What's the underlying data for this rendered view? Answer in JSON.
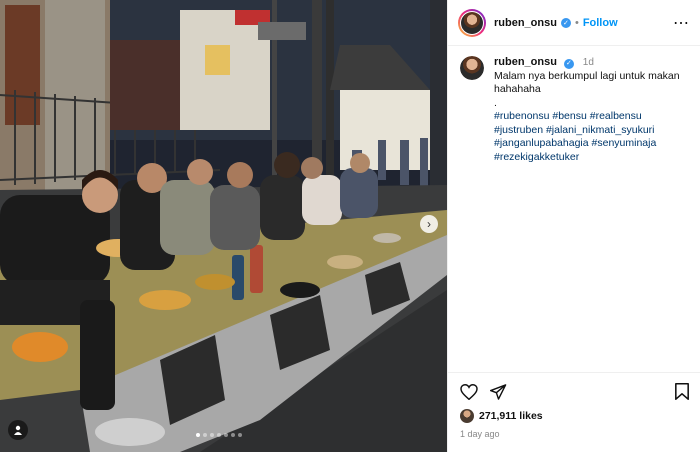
{
  "post": {
    "username": "ruben_onsu",
    "follow_label": "Follow",
    "separator": "•",
    "more_label": "⋯",
    "caption": {
      "username": "ruben_onsu",
      "time": "1d",
      "line1": "Malam nya berkumpul lagi untuk makan",
      "line2": "hahahaha",
      "line3": ".",
      "hashtags1": "#rubenonsu #bensu #realbensu",
      "hashtags2": "#justruben #jalani_nikmati_syukuri",
      "hashtags3": "#janganlupabahagia #senyuminaja",
      "hashtags4": "#rezekigakketuker"
    },
    "likes": "271,911 likes",
    "ago": "1 day ago",
    "carousel": {
      "total_slides": 7,
      "current": 1
    },
    "icons": [
      "heart-icon",
      "share-icon",
      "bookmark-icon",
      "verified-icon",
      "more-icon",
      "user-tag-icon",
      "next-icon"
    ],
    "colors": {
      "link": "#0095f6",
      "hashtag": "#00376b",
      "verified": "#3897f0"
    }
  }
}
